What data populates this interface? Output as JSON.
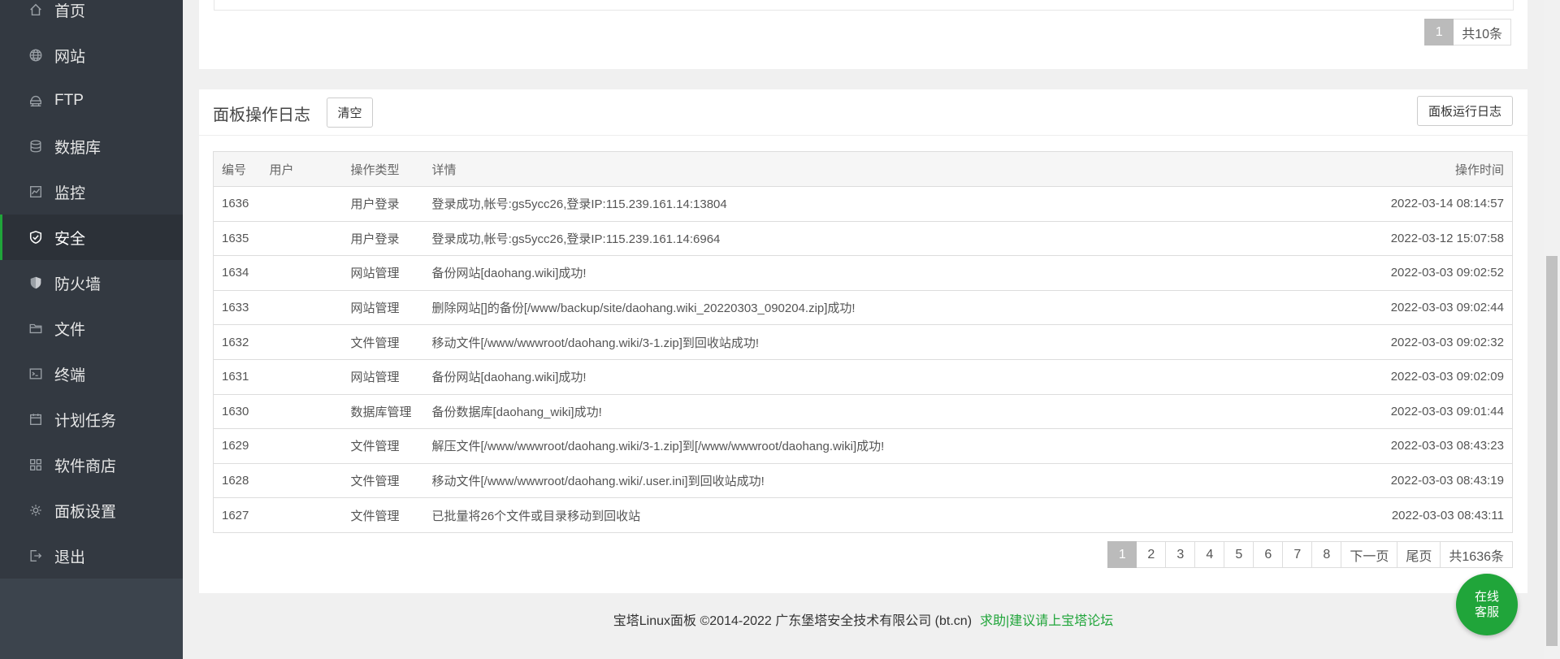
{
  "sidebar": {
    "items": [
      {
        "label": "首页",
        "icon": "home-icon"
      },
      {
        "label": "网站",
        "icon": "globe-icon"
      },
      {
        "label": "FTP",
        "icon": "ftp-icon"
      },
      {
        "label": "数据库",
        "icon": "database-icon"
      },
      {
        "label": "监控",
        "icon": "monitor-icon"
      },
      {
        "label": "安全",
        "icon": "shield-check-icon",
        "active": true
      },
      {
        "label": "防火墙",
        "icon": "firewall-shield-icon"
      },
      {
        "label": "文件",
        "icon": "folder-icon"
      },
      {
        "label": "终端",
        "icon": "terminal-icon"
      },
      {
        "label": "计划任务",
        "icon": "calendar-icon"
      },
      {
        "label": "软件商店",
        "icon": "grid-icon"
      },
      {
        "label": "面板设置",
        "icon": "gear-icon"
      },
      {
        "label": "退出",
        "icon": "logout-icon"
      }
    ]
  },
  "top_panel": {
    "pager": {
      "current": "1",
      "total": "共10条"
    }
  },
  "log_panel": {
    "title": "面板操作日志",
    "clear_label": "清空",
    "run_log_label": "面板运行日志",
    "columns": {
      "id": "编号",
      "user": "用户",
      "type": "操作类型",
      "detail": "详情",
      "time": "操作时间"
    },
    "rows": [
      {
        "id": "1636",
        "user": "",
        "type": "用户登录",
        "detail": "登录成功,帐号:gs5ycc26,登录IP:115.239.161.14:13804",
        "time": "2022-03-14 08:14:57"
      },
      {
        "id": "1635",
        "user": "",
        "type": "用户登录",
        "detail": "登录成功,帐号:gs5ycc26,登录IP:115.239.161.14:6964",
        "time": "2022-03-12 15:07:58"
      },
      {
        "id": "1634",
        "user": "",
        "type": "网站管理",
        "detail": "备份网站[daohang.wiki]成功!",
        "time": "2022-03-03 09:02:52"
      },
      {
        "id": "1633",
        "user": "",
        "type": "网站管理",
        "detail": "删除网站[]的备份[/www/backup/site/daohang.wiki_20220303_090204.zip]成功!",
        "time": "2022-03-03 09:02:44"
      },
      {
        "id": "1632",
        "user": "",
        "type": "文件管理",
        "detail": "移动文件[/www/wwwroot/daohang.wiki/3-1.zip]到回收站成功!",
        "time": "2022-03-03 09:02:32"
      },
      {
        "id": "1631",
        "user": "",
        "type": "网站管理",
        "detail": "备份网站[daohang.wiki]成功!",
        "time": "2022-03-03 09:02:09"
      },
      {
        "id": "1630",
        "user": "",
        "type": "数据库管理",
        "detail": "备份数据库[daohang_wiki]成功!",
        "time": "2022-03-03 09:01:44"
      },
      {
        "id": "1629",
        "user": "",
        "type": "文件管理",
        "detail": "解压文件[/www/wwwroot/daohang.wiki/3-1.zip]到[/www/wwwroot/daohang.wiki]成功!",
        "time": "2022-03-03 08:43:23"
      },
      {
        "id": "1628",
        "user": "",
        "type": "文件管理",
        "detail": "移动文件[/www/wwwroot/daohang.wiki/.user.ini]到回收站成功!",
        "time": "2022-03-03 08:43:19"
      },
      {
        "id": "1627",
        "user": "",
        "type": "文件管理",
        "detail": "已批量将26个文件或目录移动到回收站",
        "time": "2022-03-03 08:43:11"
      }
    ],
    "pager": {
      "pages": [
        "1",
        "2",
        "3",
        "4",
        "5",
        "6",
        "7",
        "8"
      ],
      "next": "下一页",
      "last": "尾页",
      "total": "共1636条"
    }
  },
  "footer": {
    "copyright": "宝塔Linux面板 ©2014-2022 广东堡塔安全技术有限公司 (bt.cn)",
    "link": "求助|建议请上宝塔论坛"
  },
  "service_button": {
    "line1": "在线",
    "line2": "客服"
  },
  "colors": {
    "accent": "#20a53a",
    "sidebar_bg": "#333941",
    "sidebar_active": "#2c3138"
  }
}
